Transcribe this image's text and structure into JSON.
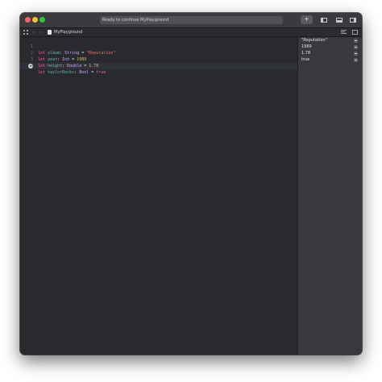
{
  "window": {
    "status_text": "Ready to continue MyPlayground",
    "add_label": "+"
  },
  "navbar": {
    "back_glyph": "‹",
    "forward_glyph": "›",
    "file_name": "MyPlayground",
    "icons": [
      "grid-icon",
      "back-icon",
      "forward-icon",
      "file-icon",
      "list-icon",
      "split-icon"
    ]
  },
  "editor": {
    "line_numbers": [
      "1",
      "2",
      "3",
      "4"
    ],
    "lines": [
      {
        "kw": "let",
        "name": "album",
        "type": "String",
        "eq": "=",
        "value": "\"Reputation\""
      },
      {
        "kw": "let",
        "name": "year",
        "type": "Int",
        "eq": "=",
        "value": "1989"
      },
      {
        "kw": "let",
        "name": "height",
        "type": "Double",
        "eq": "=",
        "value": "1.78"
      },
      {
        "kw": "let",
        "name": "taylorRocks",
        "type": "Bool",
        "eq": "=",
        "value": "true"
      }
    ]
  },
  "results": {
    "values": [
      "\"Reputation\"",
      "1989",
      "1.78",
      "true"
    ]
  },
  "colors": {
    "keyword": "#fc5fa3",
    "type": "#d0a8ff",
    "string": "#fc6a5d",
    "number": "#d0bf69",
    "variable": "#67b7a4",
    "editor_bg": "#292a30",
    "results_bg": "#38393e"
  }
}
